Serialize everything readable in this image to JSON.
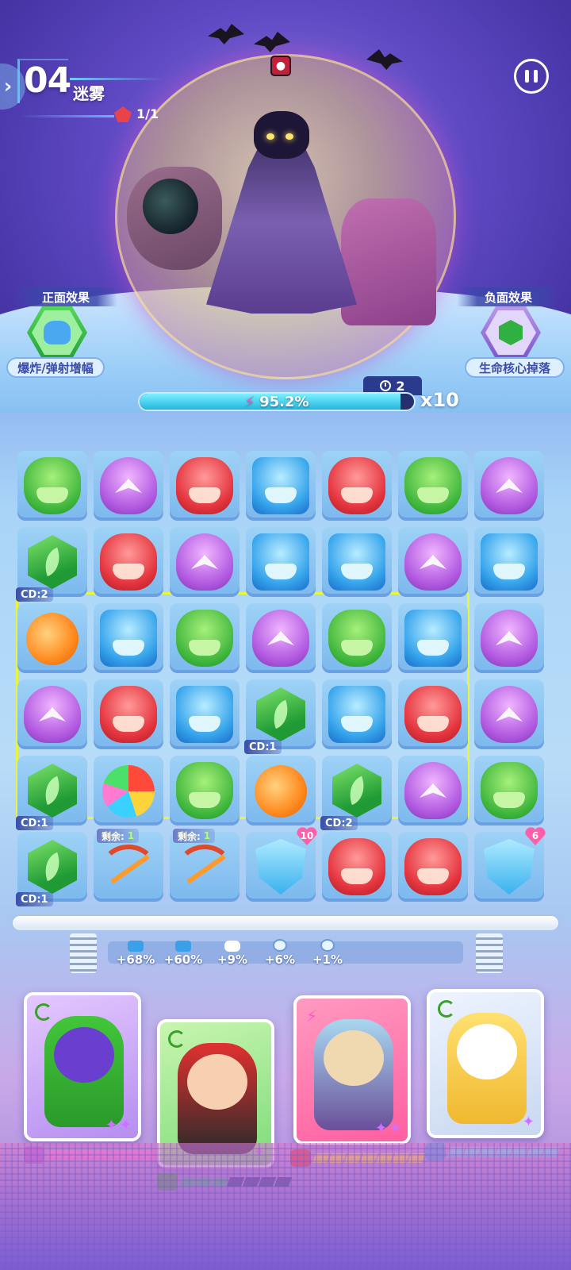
{
  "level": {
    "number": "04",
    "name": "迷雾",
    "wave": "1/1"
  },
  "effects": {
    "positive": {
      "title": "正面效果",
      "description": "爆炸/弹射增幅",
      "icon": "cat-robot-icon"
    },
    "negative": {
      "title": "负面效果",
      "description": "生命核心掉落",
      "icon": "leaf-gem-icon"
    }
  },
  "energy": {
    "percent_text": "95.2%",
    "fill": 0.952,
    "timer": "2",
    "multiplier": "x10"
  },
  "board": {
    "rows": [
      [
        {
          "type": "green"
        },
        {
          "type": "purple"
        },
        {
          "type": "red"
        },
        {
          "type": "blue"
        },
        {
          "type": "red"
        },
        {
          "type": "green"
        },
        {
          "type": "purple"
        }
      ],
      [
        {
          "type": "gem",
          "cd": "CD:2"
        },
        {
          "type": "red"
        },
        {
          "type": "purple"
        },
        {
          "type": "blue"
        },
        {
          "type": "blue"
        },
        {
          "type": "purple"
        },
        {
          "type": "blue"
        }
      ],
      [
        {
          "type": "bomb"
        },
        {
          "type": "blue"
        },
        {
          "type": "green"
        },
        {
          "type": "purple"
        },
        {
          "type": "green"
        },
        {
          "type": "blue"
        },
        {
          "type": "purple"
        }
      ],
      [
        {
          "type": "purple"
        },
        {
          "type": "red"
        },
        {
          "type": "blue"
        },
        {
          "type": "gem",
          "cd": "CD:1"
        },
        {
          "type": "blue"
        },
        {
          "type": "red"
        },
        {
          "type": "purple"
        }
      ],
      [
        {
          "type": "gem",
          "cd": "CD:1"
        },
        {
          "type": "ball"
        },
        {
          "type": "green"
        },
        {
          "type": "bomb"
        },
        {
          "type": "gem",
          "cd": "CD:2"
        },
        {
          "type": "purple"
        },
        {
          "type": "green"
        }
      ],
      [
        {
          "type": "gem",
          "cd": "CD:1"
        },
        {
          "type": "bow",
          "remain_label": "剩余:",
          "remain": "1"
        },
        {
          "type": "bow",
          "remain_label": "剩余:",
          "remain": "1"
        },
        {
          "type": "shield",
          "hp": "10"
        },
        {
          "type": "red"
        },
        {
          "type": "red"
        },
        {
          "type": "shield",
          "hp": "6"
        }
      ]
    ]
  },
  "buffs": [
    {
      "value": "+68%",
      "icon": "blue-robot-icon"
    },
    {
      "value": "+60%",
      "icon": "blue-robot-icon"
    },
    {
      "value": "+9%",
      "icon": "hand-icon"
    },
    {
      "value": "+6%",
      "icon": "shield-icon"
    },
    {
      "value": "+1%",
      "icon": "shield-icon"
    }
  ],
  "heroes": [
    {
      "name": "green-knight",
      "energy_segments_total": 7,
      "energy_segments_filled": 7,
      "bar_color": "#ff7ad8",
      "badge_color": "#b25ae0"
    },
    {
      "name": "opera-warrior",
      "energy_segments_total": 7,
      "energy_segments_filled": 3,
      "bar_color": "#3ad07a",
      "badge_color": "#3cb43a"
    },
    {
      "name": "dino-girl",
      "energy_segments_total": 7,
      "energy_segments_filled": 7,
      "bar_color": "#ffe13a",
      "badge_color": "#e4343d"
    },
    {
      "name": "astro-bear",
      "energy_segments_total": 7,
      "energy_segments_filled": 7,
      "bar_color": "#6ae8ff",
      "badge_color": "#36a4ec"
    }
  ],
  "colors": {
    "accent": "#e8f53a",
    "energy": "#22b6e0"
  }
}
